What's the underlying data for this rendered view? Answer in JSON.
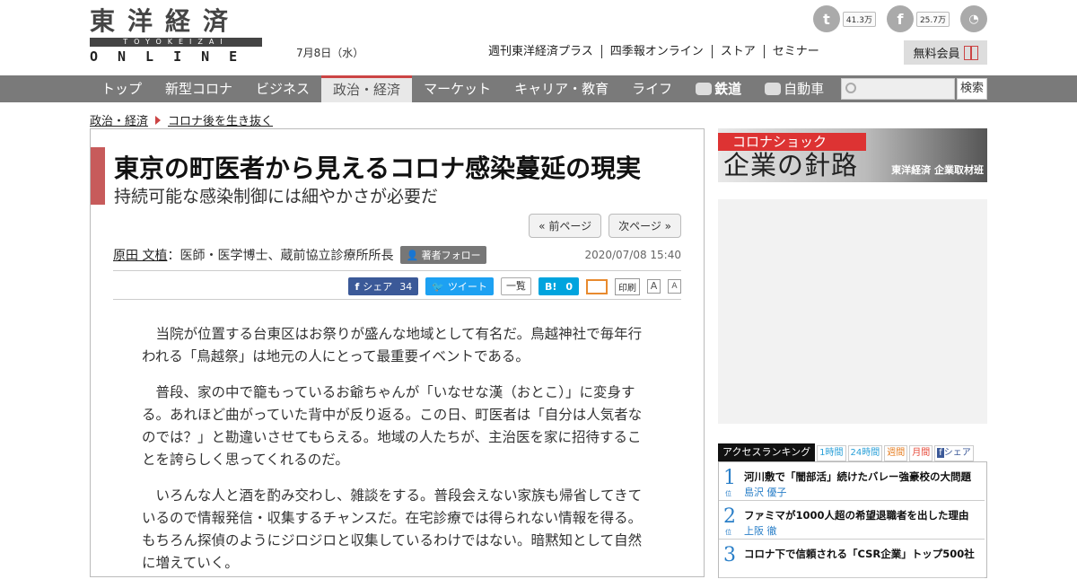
{
  "header": {
    "logo_top": "東洋経済",
    "logo_mid": "TOYOKEIZAI",
    "logo_bot": "ONLINE",
    "date": "7月8日（水）",
    "twitter_count": "41.3万",
    "facebook_count": "25.7万",
    "toplinks": [
      "週刊東洋経済プラス",
      "四季報オンライン",
      "ストア",
      "セミナー"
    ],
    "member_label": "無料会員"
  },
  "nav": {
    "items": [
      "トップ",
      "新型コロナ",
      "ビジネス",
      "政治・経済",
      "マーケット",
      "キャリア・教育",
      "ライフ",
      "鉄道",
      "自動車"
    ],
    "active_index": 3,
    "search_button": "検索"
  },
  "breadcrumb": [
    "政治・経済",
    "コロナ後を生き抜く"
  ],
  "article": {
    "title": "東京の町医者から見えるコロナ感染蔓延の現実",
    "subtitle": "持続可能な感染制御には細やかさが必要だ",
    "prev_page": "« 前ページ",
    "next_page": "次ページ »",
    "author_name": "原田 文植",
    "author_desc": "：医師・医学博士、蔵前協立診療所所長",
    "follow_label": "著者フォロー",
    "pubdate": "2020/07/08 15:40",
    "share_fb": "シェア",
    "share_fb_count": "34",
    "share_tw": "ツイート",
    "share_list": "一覧",
    "share_hb": "B!",
    "share_hb_count": "0",
    "print_label": "印刷",
    "font_a1": "A",
    "font_a2": "A",
    "paragraphs": [
      "当院が位置する台東区はお祭りが盛んな地域として有名だ。鳥越神社で毎年行われる「鳥越祭」は地元の人にとって最重要イベントである。",
      "普段、家の中で籠もっているお爺ちゃんが「いなせな漢（おとこ）」に変身する。あれほど曲がっていた背中が反り返る。この日、町医者は「自分は人気者なのでは？」と勘違いさせてもらえる。地域の人たちが、主治医を家に招待することを誇らしく思ってくれるのだ。",
      "いろんな人と酒を酌み交わし、雑談をする。普段会えない家族も帰省してきているので情報発信・収集するチャンスだ。在宅診療では得られない情報を得る。もちろん探偵のようにジロジロと収集しているわけではない。暗黙知として自然に増えていく。"
    ]
  },
  "banner": {
    "red_text": "コロナショック",
    "main_text": "企業の針路",
    "sub_text": "東洋経済 企業取材班"
  },
  "ranking": {
    "title": "アクセスランキング",
    "tabs": [
      "1時間",
      "24時間",
      "週間",
      "月間",
      "シェア"
    ],
    "items": [
      {
        "num": "1",
        "title": "河川敷で「闇部活」続けたバレー強豪校の大問題",
        "author": "島沢 優子"
      },
      {
        "num": "2",
        "title": "ファミマが1000人超の希望退職者を出した理由",
        "author": "上阪 徹"
      },
      {
        "num": "3",
        "title": "コロナ下で信頼される「CSR企業」トップ500社",
        "author": ""
      }
    ],
    "rank_suffix": "位"
  },
  "colors": {
    "accent_red": "#c44444",
    "nav_bg": "#7a7a7a",
    "rank_blue": "#2a7fc8"
  }
}
